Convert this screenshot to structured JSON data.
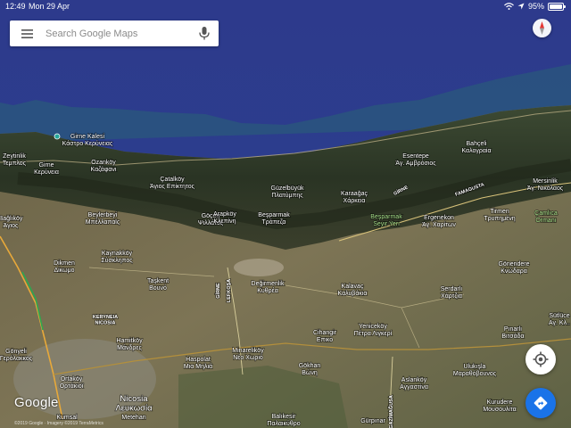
{
  "status_bar": {
    "time": "12:49",
    "date": "Mon 29 Apr",
    "battery": "95%",
    "icons": [
      "wifi-icon",
      "location-arrow-icon",
      "battery-icon"
    ]
  },
  "search": {
    "placeholder": "Search Google Maps",
    "value": "",
    "icons": [
      "menu-icon",
      "microphone-icon"
    ]
  },
  "controls": {
    "compass_icon": "compass-icon",
    "my_location_icon": "crosshair-icon",
    "directions_icon": "directions-icon",
    "directions_color": "#1a73e8"
  },
  "branding": {
    "logo": "Google",
    "copyright": "©2019 Google · Imagery ©2019 TerraMetrics"
  },
  "places": [
    {
      "line1": "Girne Kalesi",
      "line2": "Κάστρο Κερύνειας",
      "kind": "poi"
    },
    {
      "line1": "Zeytinlik",
      "line2": "Τεμπλος"
    },
    {
      "line1": "Girne",
      "line2": "Κερύνεια"
    },
    {
      "line1": "Ozanköy",
      "line2": "Καζάφανι"
    },
    {
      "line1": "Çatalköy",
      "line2": "Άγιος Επίκτητος"
    },
    {
      "line1": "Göçeri",
      "line2": "Ψιλλάτος"
    },
    {
      "line1": "Güzelbüyük",
      "line2": "Πλατύμπης"
    },
    {
      "line1": "Karaağaç",
      "line2": "Χάρκεια"
    },
    {
      "line1": "Esentepe",
      "line2": "Άγ. Αμβρόσιος"
    },
    {
      "line1": "Bahçeli",
      "line2": "Καλογραία"
    },
    {
      "line1": "Mersinlik",
      "line2": "Άγ. Νικόλαος"
    },
    {
      "line1": "Çamlıca",
      "line2": "Ormanı",
      "kind": "park"
    },
    {
      "line1": "Tirmen",
      "line2": "Τρυπημένη"
    },
    {
      "line1": "Ergenekon",
      "line2": "Άγ. Χαρίτων"
    },
    {
      "line1": "Beşparmak",
      "line2": "Seyir Yeri",
      "kind": "park"
    },
    {
      "line1": "Beşparmak",
      "line2": "Τράπεζα"
    },
    {
      "line1": "Arapköy",
      "line2": "Κλεπίνη"
    },
    {
      "line1": "Beylerbeyi",
      "line2": "Μπέλλαπαϊς"
    },
    {
      "line1": "Bağlıköy",
      "line2": "Άγιος"
    },
    {
      "line1": "Kaynakköy",
      "line2": "Σύσκληπος"
    },
    {
      "line1": "Dikmen",
      "line2": "Δίκωμο"
    },
    {
      "line1": "Taşkent",
      "line2": "Βουνό"
    },
    {
      "line1": "Değirmenlik",
      "line2": "Κυθρέα"
    },
    {
      "line1": "Kalavaç",
      "line2": "Καλυβάκια"
    },
    {
      "line1": "Gönyeli",
      "line2": "Γερόλακκος"
    },
    {
      "line1": "Hamitköy",
      "line2": "Μάνδρες"
    },
    {
      "line1": "Haspolat",
      "line2": "Μια Μηλιά"
    },
    {
      "line1": "Minareliköy",
      "line2": "Νέο Χωριό"
    },
    {
      "line1": "Gökhan",
      "line2": "Βώνη"
    },
    {
      "line1": "Cihangir",
      "line2": "Επικο"
    },
    {
      "line1": "Yeniceköy",
      "line2": "Πέτρα Λιγκερί"
    },
    {
      "line1": "Serdarlı",
      "line2": "Χάρτζια"
    },
    {
      "line1": "Gönendere",
      "line2": "Κνώδαρα"
    },
    {
      "line1": "Pınarlı",
      "line2": "Βιτσάδα"
    },
    {
      "line1": "Sütlüce",
      "line2": "Αγ. Κλ.."
    },
    {
      "line1": "Ulukışla",
      "line2": "Μαραθόβουνος"
    },
    {
      "line1": "Aslanköy",
      "line2": "Αγγαστίνα"
    },
    {
      "line1": "Kurudere",
      "line2": "Μουσουλίτα"
    },
    {
      "line1": "Balıkesir",
      "line2": "Παλαικύθρο"
    },
    {
      "line1": "Gürpınar",
      "line2": ""
    },
    {
      "line1": "Nicosia",
      "line2": "Λευκωσία",
      "kind": "city"
    },
    {
      "line1": "KERYNEIA",
      "line2": "NICOSIA",
      "kind": "district"
    },
    {
      "line1": "GİRNE",
      "line2": "",
      "kind": "road"
    },
    {
      "line1": "GİRNE",
      "line2": "",
      "kind": "road"
    },
    {
      "line1": "LEFKOŞA",
      "line2": "",
      "kind": "road"
    },
    {
      "line1": "FAMAGUSTA",
      "line2": "",
      "kind": "road"
    },
    {
      "line1": "GAZİMAĞUSA",
      "line2": "",
      "kind": "road"
    },
    {
      "line1": "Ortaköy",
      "line2": "Ορτάκιοϊ"
    },
    {
      "line1": "Kumsal",
      "line2": ""
    },
    {
      "line1": "Metehan",
      "line2": ""
    }
  ]
}
